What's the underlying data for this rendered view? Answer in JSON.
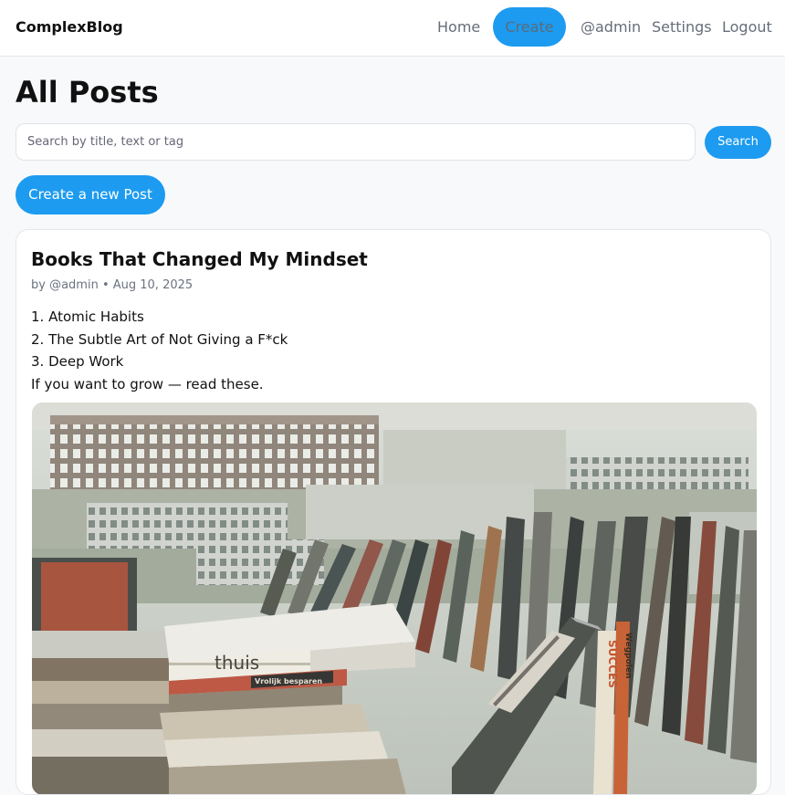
{
  "app": {
    "brand": "ComplexBlog"
  },
  "nav": {
    "home": "Home",
    "create": "Create",
    "user": "@admin",
    "settings": "Settings",
    "logout": "Logout"
  },
  "page": {
    "title": "All Posts"
  },
  "search": {
    "placeholder": "Search by title, text or tag",
    "value": "",
    "button": "Search"
  },
  "actions": {
    "create_post": "Create a new Post"
  },
  "posts": [
    {
      "title": "Books That Changed My Mindset",
      "meta": "by @admin • Aug 10, 2025",
      "body": [
        "1. Atomic Habits",
        "2. The Subtle Art of Not Giving a F*ck",
        "3. Deep Work",
        "If you want to grow — read these."
      ],
      "image": {
        "subject": "stacks-of-books-photo",
        "spine_texts": [
          "thuis",
          "Vrolijk besparen",
          "SUCCES",
          "Wegpolen"
        ]
      }
    }
  ],
  "colors": {
    "accent": "#1d9bf0",
    "muted_text": "#666e7a"
  }
}
